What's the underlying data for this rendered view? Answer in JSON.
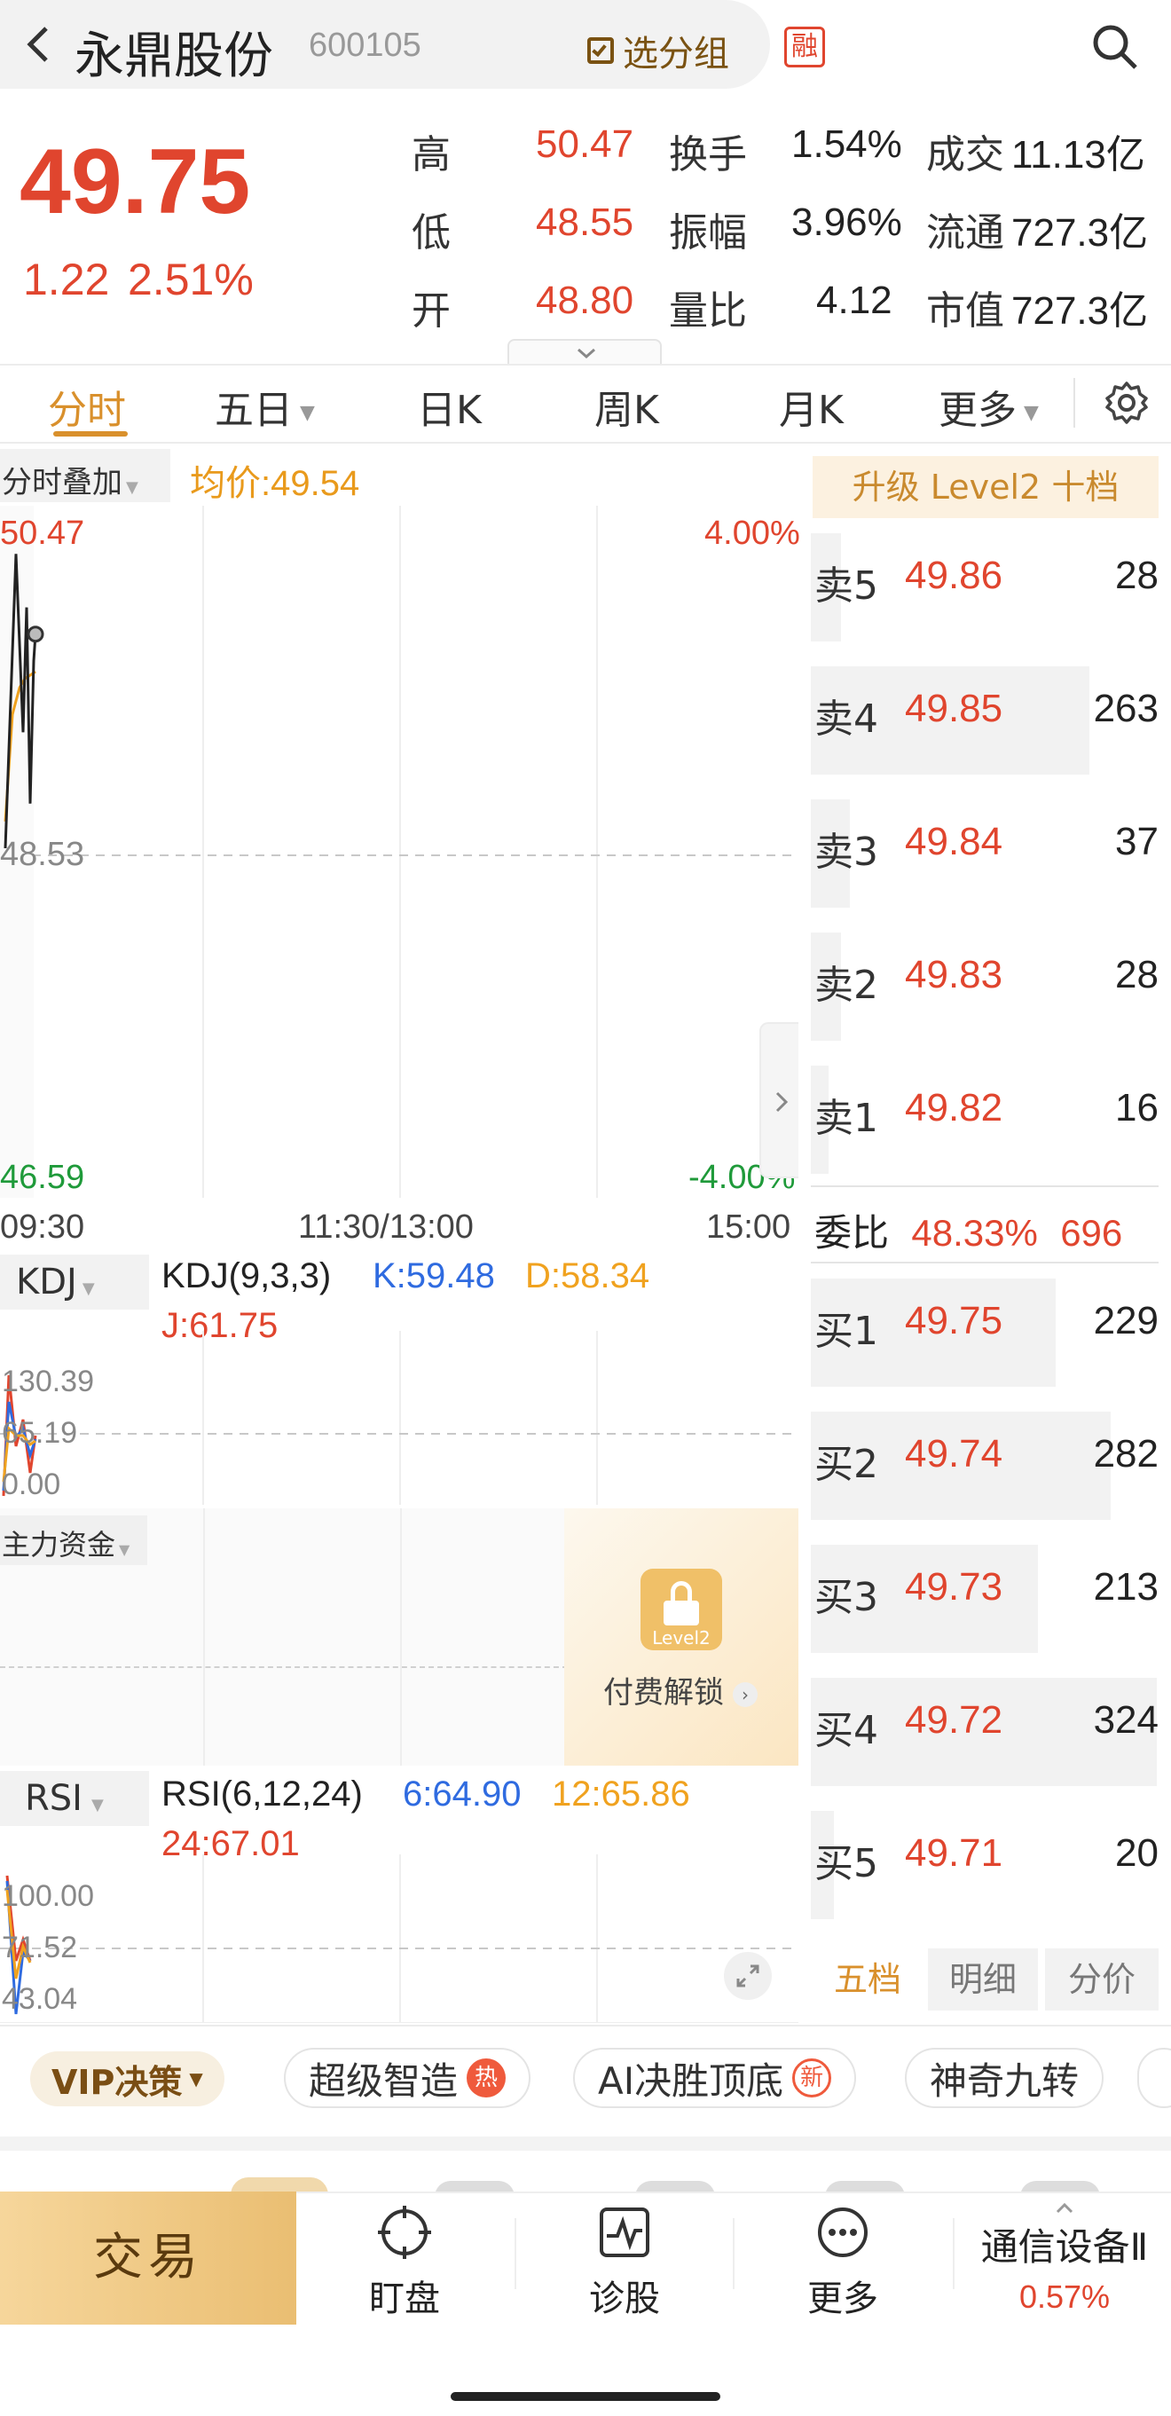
{
  "header": {
    "back_icon": "chevron-left-icon",
    "stock_name": "永鼎股份",
    "stock_code": "600105",
    "group_label": "选分组",
    "margin_badge": "融",
    "search_icon": "search-icon"
  },
  "quote": {
    "price": "49.75",
    "change": "1.22",
    "change_pct": "2.51%",
    "rows": [
      {
        "l1": "高",
        "v1": "50.47",
        "l2": "换手",
        "v2": "1.54%",
        "l3": "成交",
        "v3": "11.13亿"
      },
      {
        "l1": "低",
        "v1": "48.55",
        "l2": "振幅",
        "v2": "3.96%",
        "l3": "流通",
        "v3": "727.3亿"
      },
      {
        "l1": "开",
        "v1": "48.80",
        "l2": "量比",
        "v2": "4.12",
        "l3": "市值",
        "v3": "727.3亿"
      }
    ]
  },
  "tabs": [
    "分时",
    "五日",
    "日K",
    "周K",
    "月K",
    "更多"
  ],
  "chart": {
    "overlay_label": "分时叠加",
    "avg_label": "均价:49.54",
    "y_high": "50.47",
    "y_mid": "48.53",
    "y_low": "46.59",
    "pct_high": "4.00%",
    "pct_low": "-4.00%",
    "t_open": "09:30",
    "t_mid": "11:30/13:00",
    "t_close": "15:00",
    "chart_data": {
      "type": "line",
      "series": [
        {
          "values": [
            48.55,
            50.2,
            49.2,
            49.9,
            48.8,
            49.6,
            49.75
          ]
        },
        {
          "values": [
            48.7,
            49.3,
            49.45,
            49.5,
            49.52,
            49.54
          ]
        }
      ],
      "ylim": [
        46.59,
        50.47
      ]
    }
  },
  "kdj": {
    "label": "KDJ",
    "title": "KDJ(9,3,3)",
    "k": "K:59.48",
    "d": "D:58.34",
    "j": "J:61.75",
    "y1": "130.39",
    "y2": "65.19",
    "y3": "0.00"
  },
  "fund": {
    "label": "主力资金",
    "badge": "Level2",
    "unlock": "付费解锁"
  },
  "rsi": {
    "label": "RSI",
    "title": "RSI(6,12,24)",
    "r6": "6:64.90",
    "r12": "12:65.86",
    "r24": "24:67.01",
    "y1": "100.00",
    "y2": "71.52",
    "y3": "43.04"
  },
  "orderbook": {
    "upgrade": "升级 Level2 十档",
    "sells": [
      {
        "label": "卖5",
        "price": "49.86",
        "vol": "28"
      },
      {
        "label": "卖4",
        "price": "49.85",
        "vol": "263"
      },
      {
        "label": "卖3",
        "price": "49.84",
        "vol": "37"
      },
      {
        "label": "卖2",
        "price": "49.83",
        "vol": "28"
      },
      {
        "label": "卖1",
        "price": "49.82",
        "vol": "16"
      }
    ],
    "ratio_label": "委比",
    "ratio_pct": "48.33%",
    "ratio_vol": "696",
    "buys": [
      {
        "label": "买1",
        "price": "49.75",
        "vol": "229"
      },
      {
        "label": "买2",
        "price": "49.74",
        "vol": "282"
      },
      {
        "label": "买3",
        "price": "49.73",
        "vol": "213"
      },
      {
        "label": "买4",
        "price": "49.72",
        "vol": "324"
      },
      {
        "label": "买5",
        "price": "49.71",
        "vol": "20"
      }
    ],
    "tabs": [
      "五档",
      "明细",
      "分价"
    ]
  },
  "features": {
    "vip": "VIP决策",
    "chips": [
      "超级智造",
      "AI决胜顶底",
      "神奇九转"
    ],
    "hot": "热",
    "new": "新"
  },
  "bottom": {
    "trade": "交易",
    "items": [
      "盯盘",
      "诊股",
      "更多"
    ],
    "sector": "通信设备Ⅱ",
    "sector_pct": "0.57%"
  },
  "colors": {
    "up": "#e0452e",
    "down": "#1f9a3a",
    "accent": "#d9902c"
  }
}
